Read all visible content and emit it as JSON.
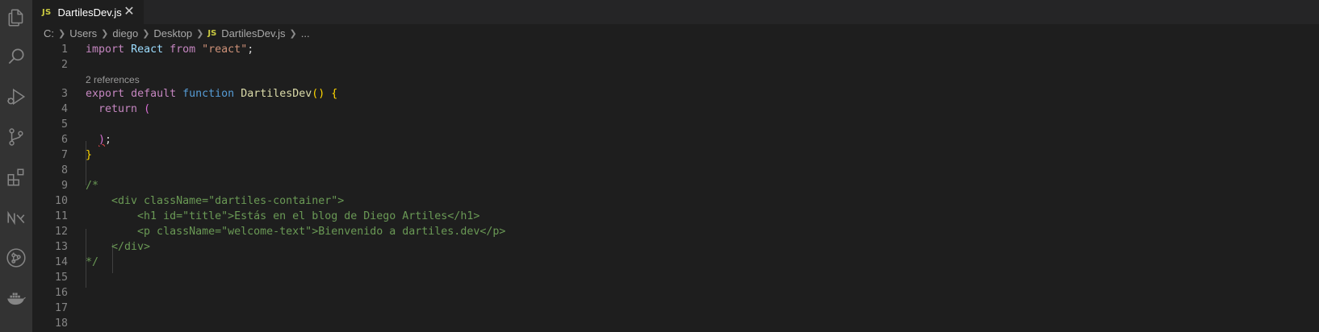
{
  "activity_bar": {
    "icons": [
      "explorer-icon",
      "search-icon",
      "run-debug-icon",
      "source-control-icon",
      "extensions-icon",
      "nx-console-icon",
      "git-graph-icon",
      "docker-icon"
    ]
  },
  "tab": {
    "badge": "JS",
    "label": "DartilesDev.js",
    "close": "✕"
  },
  "breadcrumb": {
    "items": [
      "C:",
      "Users",
      "diego",
      "Desktop"
    ],
    "file_badge": "JS",
    "file": "DartilesDev.js",
    "more": "..."
  },
  "editor": {
    "line_numbers": [
      "1",
      "2",
      "3",
      "4",
      "5",
      "6",
      "7",
      "8",
      "9",
      "10",
      "11",
      "12",
      "13",
      "14",
      "15",
      "16",
      "17",
      "18"
    ],
    "codelens": "2 references",
    "lines": {
      "l1": {
        "t1": "import",
        "t2": "React",
        "t3": "from",
        "t4": "\"react\"",
        "t5": ";"
      },
      "l3": {
        "t1": "export",
        "t2": "default",
        "t3": "function",
        "t4": "DartilesDev",
        "t5": "()",
        "t6": "{"
      },
      "l4": {
        "t1": "return",
        "t2": "("
      },
      "l6": {
        "t1": ")",
        "t2": ";"
      },
      "l7": {
        "t1": "}"
      },
      "l9": "/*",
      "l10": "    <div className=\"dartiles-container\">",
      "l11": "        <h1 id=\"title\">Estás en el blog de Diego Artiles</h1>",
      "l12": "        <p className=\"welcome-text\">Bienvenido a dartiles.dev</p>",
      "l13": "    </div>",
      "l14": "*/"
    }
  }
}
